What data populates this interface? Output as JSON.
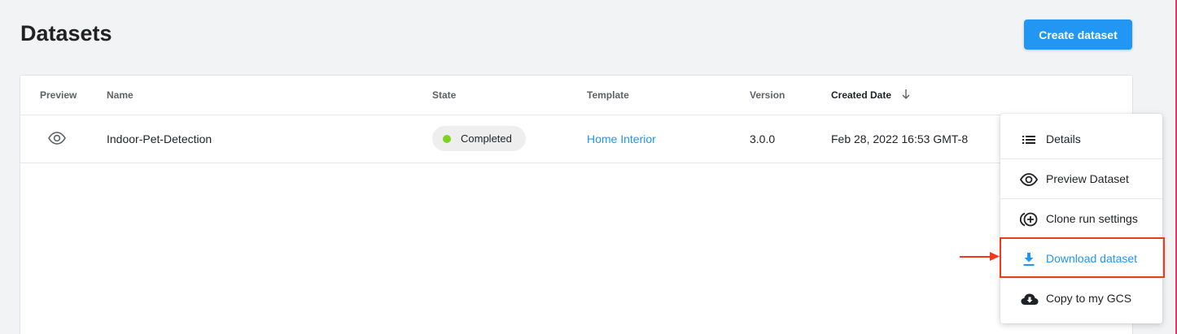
{
  "page": {
    "title": "Datasets"
  },
  "toolbar": {
    "create_label": "Create dataset"
  },
  "table": {
    "columns": [
      {
        "label": "Preview"
      },
      {
        "label": "Name"
      },
      {
        "label": "State"
      },
      {
        "label": "Template"
      },
      {
        "label": "Version"
      },
      {
        "label": "Created Date",
        "sorted": "descending"
      }
    ],
    "rows": [
      {
        "preview_icon": "eye-icon",
        "name": "Indoor-Pet-Detection",
        "state": "Completed",
        "state_color": "#7ed321",
        "template": "Home Interior",
        "version": "3.0.0",
        "created": "Feb 28, 2022 16:53 GMT-8"
      }
    ]
  },
  "menu": {
    "items": [
      {
        "label": "Details",
        "icon": "list-icon"
      },
      {
        "label": "Preview Dataset",
        "icon": "eye-icon"
      },
      {
        "label": "Clone run settings",
        "icon": "clone-add-icon"
      },
      {
        "label": "Download dataset",
        "icon": "download-icon",
        "highlighted": true
      },
      {
        "label": "Copy to my GCS",
        "icon": "cloud-download-icon"
      }
    ]
  },
  "colors": {
    "accent": "#2196f3",
    "highlight_border": "#ee3b1c",
    "status_completed": "#7ed321",
    "page_background": "#f2f3f5"
  }
}
